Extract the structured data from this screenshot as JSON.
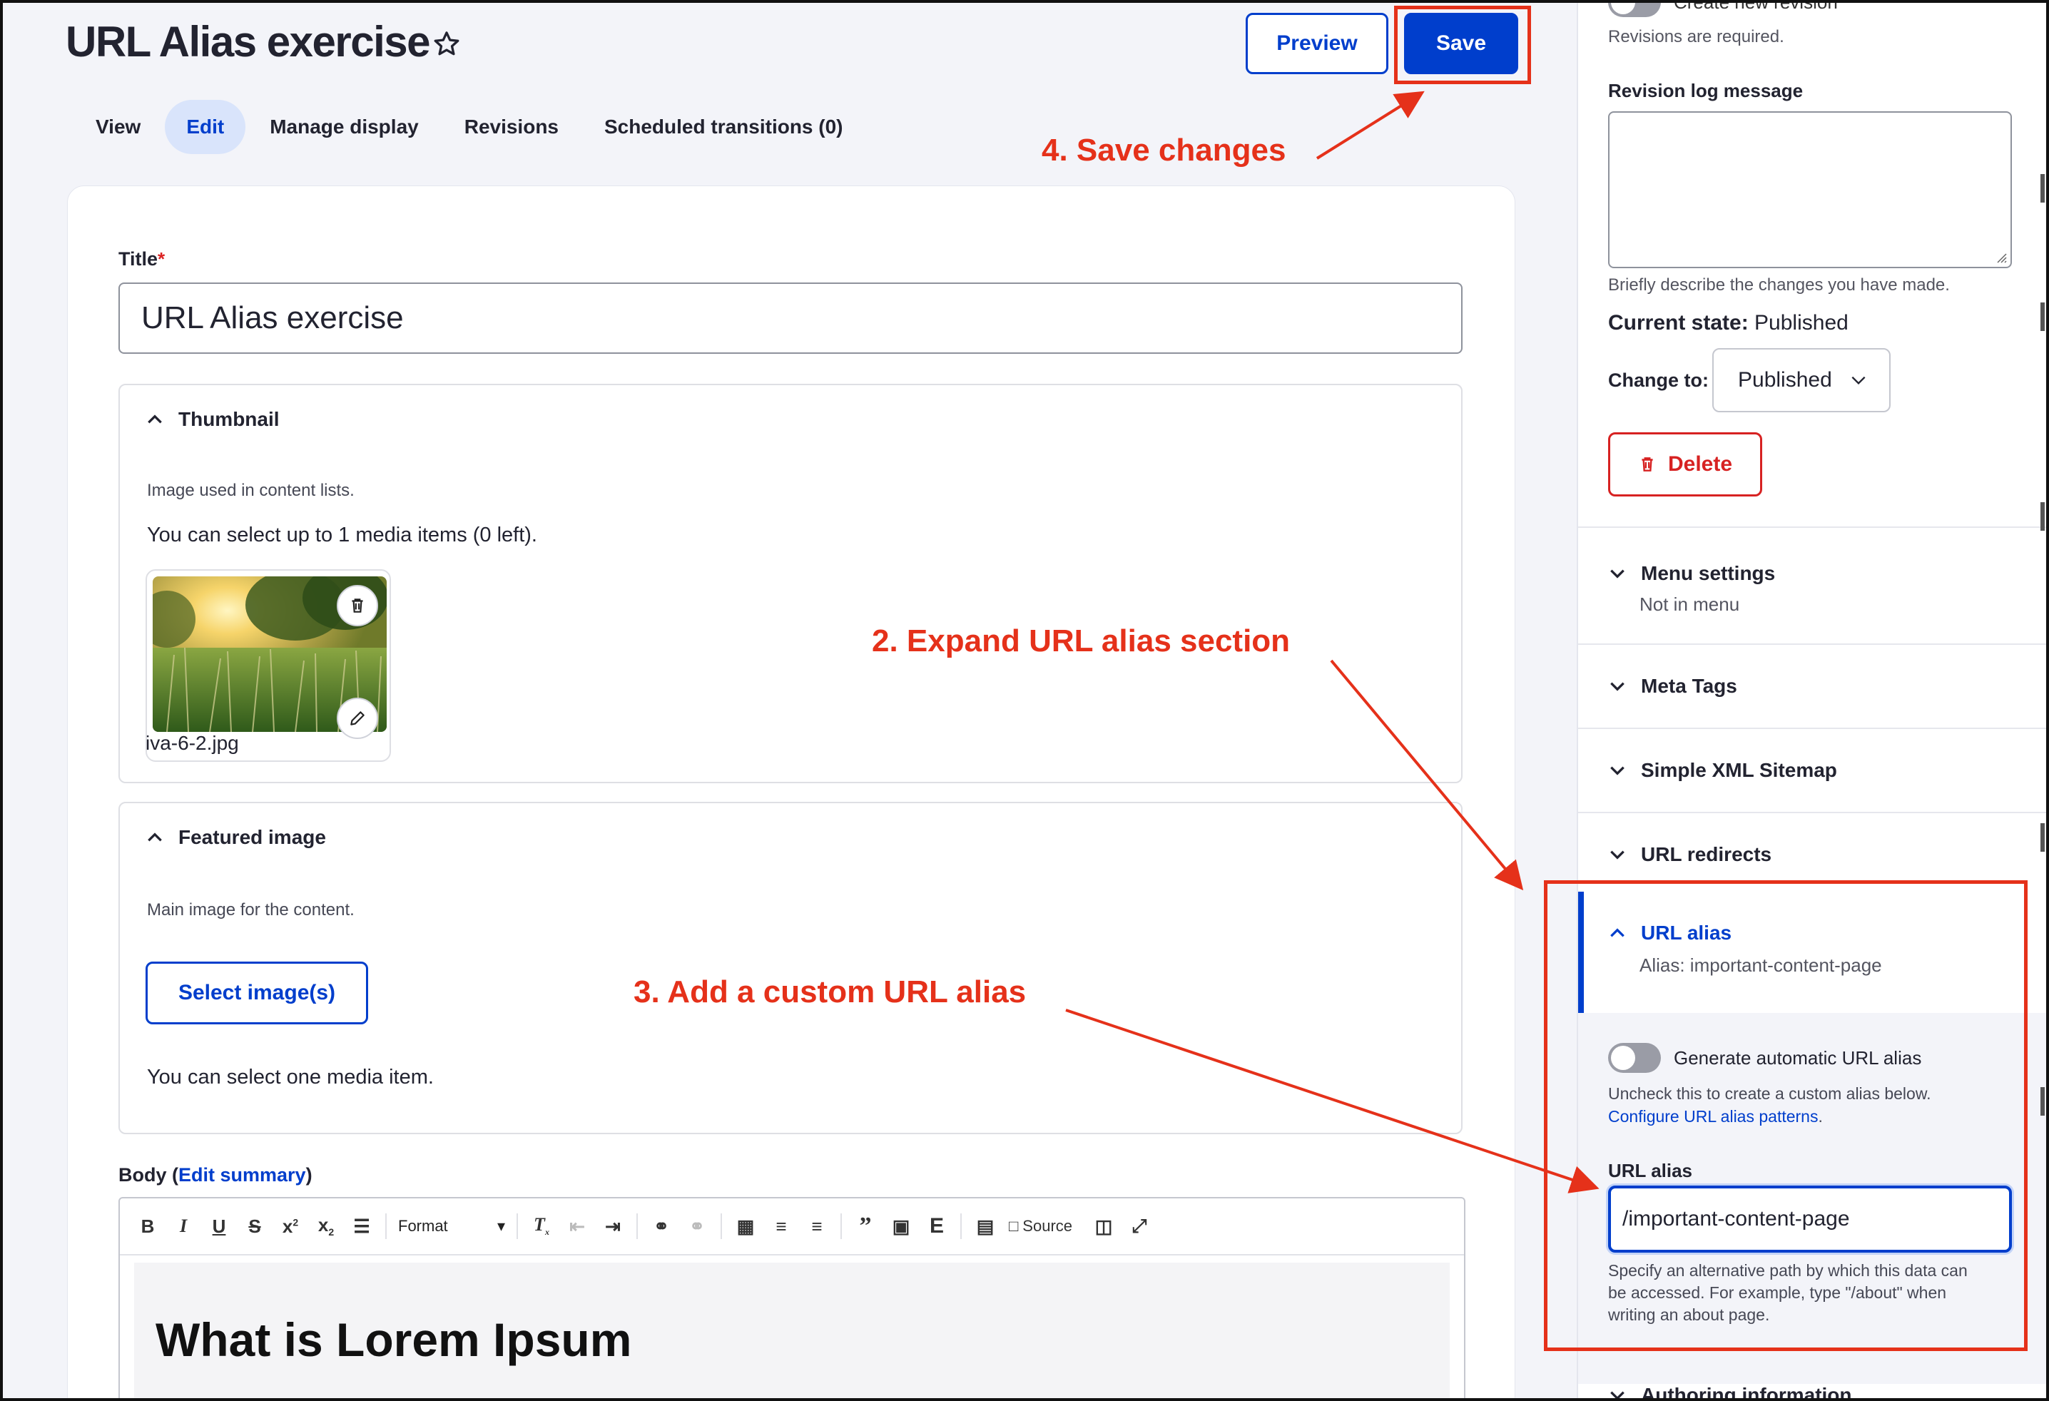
{
  "page": {
    "title": "URL Alias exercise",
    "preview_label": "Preview",
    "save_label": "Save"
  },
  "tabs": [
    {
      "label": "View",
      "active": false
    },
    {
      "label": "Edit",
      "active": true
    },
    {
      "label": "Manage display",
      "active": false
    },
    {
      "label": "Revisions",
      "active": false
    },
    {
      "label": "Scheduled transitions (0)",
      "active": false
    }
  ],
  "form": {
    "title_label": "Title",
    "required_mark": "*",
    "title_value": "URL Alias exercise",
    "thumbnail": {
      "label": "Thumbnail",
      "description": "Image used in content lists.",
      "limit_text": "You can select up to 1 media items (0 left).",
      "file_name": "iva-6-2.jpg"
    },
    "featured_image": {
      "label": "Featured image",
      "description": "Main image for the content.",
      "select_label": "Select image(s)",
      "limit_text": "You can select one media item."
    },
    "body": {
      "label_prefix": "Body (",
      "edit_summary": "Edit summary",
      "label_suffix": ")",
      "toolbar": {
        "format_label": "Format",
        "source_label": "Source"
      },
      "heading": "What is Lorem Ipsum"
    }
  },
  "sidebar": {
    "create_revision_label": "Create new revision",
    "revisions_required": "Revisions are required.",
    "revision_log_label": "Revision log message",
    "revision_log_help": "Briefly describe the changes you have made.",
    "current_state_label": "Current state:",
    "current_state_value": "Published",
    "change_to_label": "Change to:",
    "change_to_value": "Published",
    "delete_label": "Delete",
    "sections": {
      "menu_settings": {
        "label": "Menu settings",
        "summary": "Not in menu"
      },
      "meta_tags": {
        "label": "Meta Tags"
      },
      "simple_xml_sitemap": {
        "label": "Simple XML Sitemap"
      },
      "url_redirects": {
        "label": "URL redirects"
      },
      "url_alias": {
        "label": "URL alias",
        "summary": "Alias: important-content-page"
      },
      "authoring_information": {
        "label": "Authoring information"
      }
    },
    "url_alias_panel": {
      "generate_label": "Generate automatic URL alias",
      "generate_checked": false,
      "uncheck_help": "Uncheck this to create a custom alias below.",
      "configure_link": "Configure URL alias patterns",
      "configure_suffix": ".",
      "alias_label": "URL alias",
      "alias_value": "/important-content-page",
      "alias_help_1": "Specify an alternative path by which this data can",
      "alias_help_2": "be accessed. For example, type \"/about\" when",
      "alias_help_3": "writing an about page."
    }
  },
  "annotations": {
    "step2": "2. Expand URL alias section",
    "step3": "3. Add a custom URL alias",
    "step4": "4. Save changes",
    "color": "#e5311a"
  },
  "colors": {
    "accent": "#003ecc",
    "danger": "#d72222",
    "background": "#f3f4f9"
  }
}
